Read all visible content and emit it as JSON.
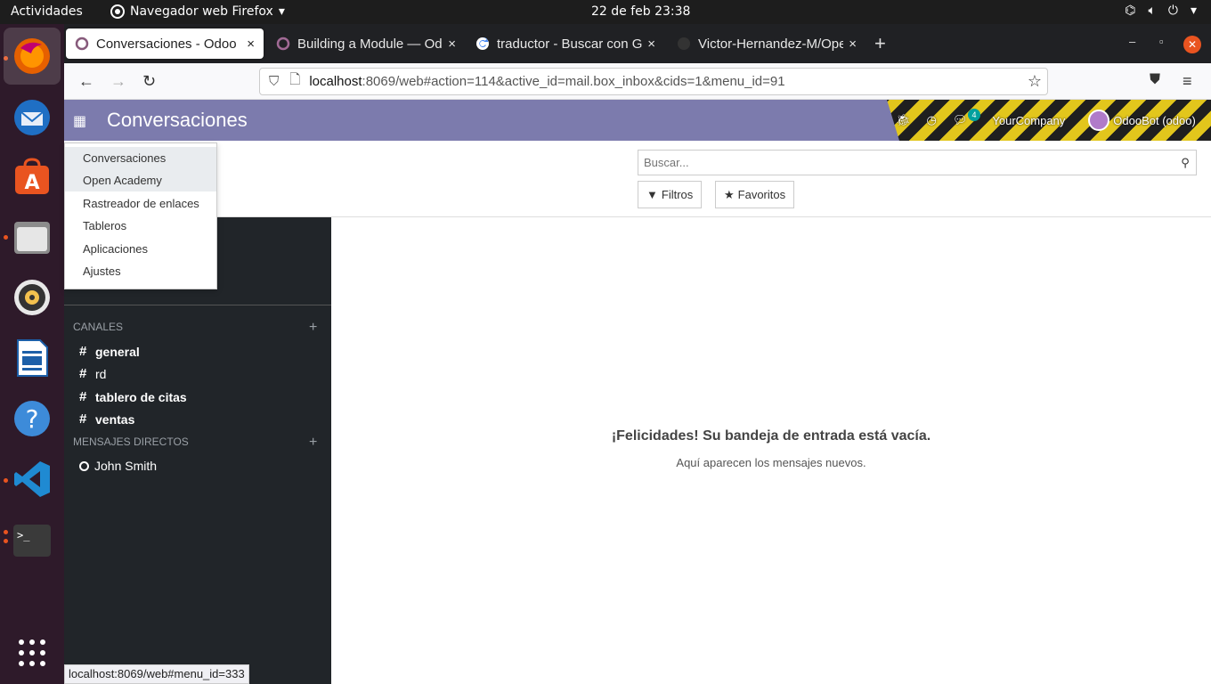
{
  "topbar": {
    "activities": "Actividades",
    "app_menu": "Navegador web Firefox",
    "clock": "22 de feb  23:38"
  },
  "dock": {
    "items": [
      "firefox-icon",
      "thunderbird-icon",
      "software-center-icon",
      "files-icon",
      "rhythmbox-icon",
      "libreoffice-writer-icon",
      "help-icon",
      "vscode-icon",
      "terminal-icon",
      "show-apps-icon"
    ]
  },
  "browser": {
    "tabs": [
      {
        "label": "Conversaciones - Odoo"
      },
      {
        "label": "Building a Module — Odoo"
      },
      {
        "label": "traductor - Buscar con Google"
      },
      {
        "label": "Victor-Hernandez-M/Open"
      }
    ],
    "url_host": "localhost",
    "url_rest": ":8069/web#action=114&active_id=mail.box_inbox&cids=1&menu_id=91",
    "status_url": "localhost:8069/web#menu_id=333"
  },
  "odoo": {
    "app_title": "Conversaciones",
    "systray": {
      "chat_badge": "4",
      "company": "YourCompany",
      "user": "OdooBot (odoo)"
    },
    "apps_menu": [
      "Conversaciones",
      "Open Academy",
      "Rastreador de enlaces",
      "Tableros",
      "Aplicaciones",
      "Ajustes"
    ],
    "search": {
      "placeholder": "Buscar..."
    },
    "filters_label": "Filtros",
    "favorites_label": "Favoritos",
    "sidebar": {
      "channels_header": "CANALES",
      "channels": [
        {
          "name": "general",
          "bold": true
        },
        {
          "name": "rd",
          "bold": false
        },
        {
          "name": "tablero de citas",
          "bold": true
        },
        {
          "name": "ventas",
          "bold": true
        }
      ],
      "direct_header": "MENSAJES DIRECTOS",
      "direct": [
        {
          "name": "John Smith"
        }
      ]
    },
    "empty": {
      "title": "¡Felicidades! Su bandeja de entrada está vacía.",
      "subtitle": "Aquí aparecen los mensajes nuevos."
    }
  }
}
